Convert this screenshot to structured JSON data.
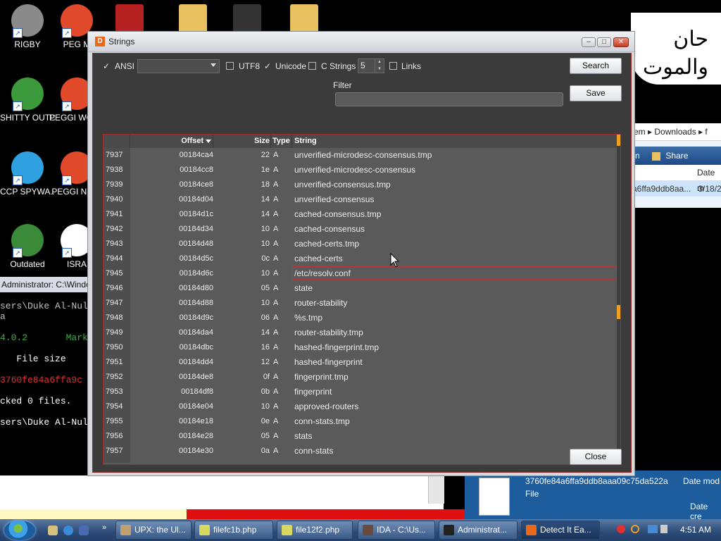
{
  "desktop": {
    "icons": [
      {
        "label": "RIGBY",
        "icon": "raccoon-icon",
        "color": "#8a8a8a"
      },
      {
        "label": "PEG M",
        "icon": "pegasus-p-icon",
        "color": "#e04a2a"
      },
      {
        "label": "",
        "icon": "flash-icon",
        "color": "#b52020"
      },
      {
        "label": "",
        "icon": "hxd-icon",
        "color": "#e8c060"
      },
      {
        "label": "",
        "icon": "console-icon",
        "color": "#333333"
      },
      {
        "label": "",
        "icon": "folder-icon",
        "color": "#e8c060"
      },
      {
        "label": "SHITTY OUTDAT...",
        "icon": "chrome-icon",
        "color": "#3c9a3c"
      },
      {
        "label": "PEGGI WOW N",
        "icon": "pegasus-p-icon",
        "color": "#e04a2a"
      },
      {
        "label": "CCP SPYWA...",
        "icon": "pinwheel-icon",
        "color": "#2fa0e0"
      },
      {
        "label": "PEGGI NIGH",
        "icon": "pegasus-p-icon",
        "color": "#e04a2a"
      },
      {
        "label": "Outdated",
        "icon": "download-manager-icon",
        "color": "#3a8a3a"
      },
      {
        "label": "ISRA",
        "icon": "flower-icon",
        "color": "#ffffff"
      }
    ],
    "arabic_line1": "حان",
    "arabic_line2": "والموت"
  },
  "cmd": {
    "title": "Administrator: C:\\Windows",
    "lines": [
      {
        "text": "sers\\Duke Al-Nul",
        "color": "#c0c0c0"
      },
      {
        "text": "a",
        "color": "#c0c0c0"
      },
      {
        "text": "",
        "color": "#c0c0c0"
      },
      {
        "text": "4.0.2       Mark",
        "color": "#3cb043"
      },
      {
        "text": "",
        "color": "#c0c0c0"
      },
      {
        "text": "   File size",
        "color": "#ffffff"
      },
      {
        "text": "",
        "color": "#c0c0c0"
      },
      {
        "text": "3760fe84a6ffa9c",
        "color": "#e03030"
      },
      {
        "text": "",
        "color": "#c0c0c0"
      },
      {
        "text": "cked 0 files.",
        "color": "#ffffff"
      },
      {
        "text": "",
        "color": "#c0c0c0"
      },
      {
        "text": "sers\\Duke Al-Nul",
        "color": "#ffffff"
      }
    ]
  },
  "explorer": {
    "breadcrumb": "em  ▸ Downloads ▸ f",
    "toolbar_tail": "n",
    "share": "Share",
    "col_date": "Date m",
    "row_name": "a6ffa9ddb8aa...",
    "row_date": "3/18/2"
  },
  "infopane": {
    "filename": "3760fe84a6ffa9ddb8aaa09c75da522a",
    "date_modified_label": "Date mod",
    "type": "File",
    "date_created_label": "Date cre"
  },
  "dialog": {
    "title": "Strings",
    "options": {
      "ansi_label": "ANSI",
      "ansi_checked": true,
      "encoding_value": "",
      "utf8_label": "UTF8",
      "utf8_checked": false,
      "unicode_label": "Unicode",
      "unicode_checked": true,
      "cstrings_label": "C Strings",
      "cstrings_checked": false,
      "min_length": "5",
      "links_label": "Links",
      "links_checked": false
    },
    "filter_label": "Filter",
    "filter_value": "",
    "buttons": {
      "search": "Search",
      "save": "Save",
      "close": "Close"
    },
    "columns": {
      "offset": "Offset",
      "size": "Size",
      "type": "Type",
      "string": "String"
    },
    "selected_row": "7945",
    "rows": [
      {
        "n": "7937",
        "offset": "00184ca4",
        "size": "22",
        "type": "A",
        "string": "unverified-microdesc-consensus.tmp"
      },
      {
        "n": "7938",
        "offset": "00184cc8",
        "size": "1e",
        "type": "A",
        "string": "unverified-microdesc-consensus"
      },
      {
        "n": "7939",
        "offset": "00184ce8",
        "size": "18",
        "type": "A",
        "string": "unverified-consensus.tmp"
      },
      {
        "n": "7940",
        "offset": "00184d04",
        "size": "14",
        "type": "A",
        "string": "unverified-consensus"
      },
      {
        "n": "7941",
        "offset": "00184d1c",
        "size": "14",
        "type": "A",
        "string": "cached-consensus.tmp"
      },
      {
        "n": "7942",
        "offset": "00184d34",
        "size": "10",
        "type": "A",
        "string": "cached-consensus"
      },
      {
        "n": "7943",
        "offset": "00184d48",
        "size": "10",
        "type": "A",
        "string": "cached-certs.tmp"
      },
      {
        "n": "7944",
        "offset": "00184d5c",
        "size": "0c",
        "type": "A",
        "string": "cached-certs"
      },
      {
        "n": "7945",
        "offset": "00184d6c",
        "size": "10",
        "type": "A",
        "string": "/etc/resolv.conf"
      },
      {
        "n": "7946",
        "offset": "00184d80",
        "size": "05",
        "type": "A",
        "string": "state"
      },
      {
        "n": "7947",
        "offset": "00184d88",
        "size": "10",
        "type": "A",
        "string": "router-stability"
      },
      {
        "n": "7948",
        "offset": "00184d9c",
        "size": "06",
        "type": "A",
        "string": "%s.tmp"
      },
      {
        "n": "7949",
        "offset": "00184da4",
        "size": "14",
        "type": "A",
        "string": "router-stability.tmp"
      },
      {
        "n": "7950",
        "offset": "00184dbc",
        "size": "16",
        "type": "A",
        "string": "hashed-fingerprint.tmp"
      },
      {
        "n": "7951",
        "offset": "00184dd4",
        "size": "12",
        "type": "A",
        "string": "hashed-fingerprint"
      },
      {
        "n": "7952",
        "offset": "00184de8",
        "size": "0f",
        "type": "A",
        "string": "fingerprint.tmp"
      },
      {
        "n": "7953",
        "offset": "00184df8",
        "size": "0b",
        "type": "A",
        "string": "fingerprint"
      },
      {
        "n": "7954",
        "offset": "00184e04",
        "size": "10",
        "type": "A",
        "string": "approved-routers"
      },
      {
        "n": "7955",
        "offset": "00184e18",
        "size": "0e",
        "type": "A",
        "string": "conn-stats.tmp"
      },
      {
        "n": "7956",
        "offset": "00184e28",
        "size": "05",
        "type": "A",
        "string": "stats"
      },
      {
        "n": "7957",
        "offset": "00184e30",
        "size": "0a",
        "type": "A",
        "string": "conn-stats"
      }
    ],
    "accent_color": "#f0a020",
    "border_color": "#a02c2c"
  },
  "taskbar": {
    "buttons": [
      {
        "label": "UPX: the Ul...",
        "icon": "upx-icon",
        "color": "#c0a070",
        "active": false
      },
      {
        "label": "filefc1b.php",
        "icon": "php-file-icon",
        "color": "#d8d860",
        "active": false
      },
      {
        "label": "file12f2.php",
        "icon": "php-file-icon",
        "color": "#d8d860",
        "active": false
      },
      {
        "label": "IDA - C:\\Us...",
        "icon": "ida-icon",
        "color": "#6a4a3a",
        "active": false
      },
      {
        "label": "Administrat...",
        "icon": "cmd-icon",
        "color": "#222222",
        "active": false
      },
      {
        "label": "Detect It Ea...",
        "icon": "die-icon",
        "color": "#e9681a",
        "active": true
      }
    ],
    "time": "4:51 AM"
  }
}
